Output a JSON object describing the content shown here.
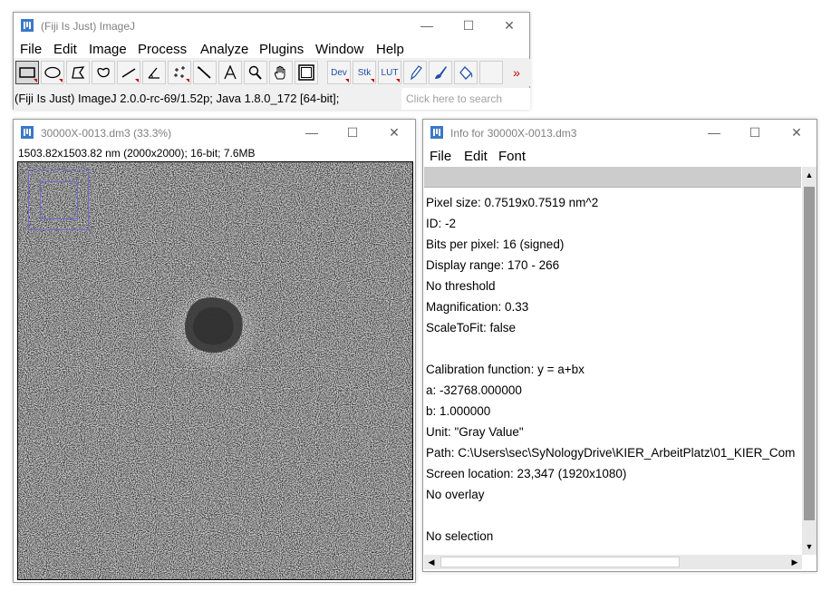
{
  "main_window": {
    "title": "(Fiji Is Just) ImageJ",
    "menus": [
      "File",
      "Edit",
      "Image",
      "Process",
      "Analyze",
      "Plugins",
      "Window",
      "Help"
    ],
    "tools": {
      "dev": "Dev",
      "stk": "Stk",
      "lut": "LUT",
      "more": "»"
    },
    "status": "(Fiji Is Just) ImageJ 2.0.0-rc-69/1.52p; Java 1.8.0_172 [64-bit];",
    "search_placeholder": "Click here to search"
  },
  "image_window": {
    "title": "30000X-0013.dm3 (33.3%)",
    "info": "1503.82x1503.82 nm (2000x2000); 16-bit; 7.6MB"
  },
  "info_window": {
    "title": "Info for 30000X-0013.dm3",
    "menus": [
      "File",
      "Edit",
      "Font"
    ],
    "lines": [
      "Pixel size: 0.7519x0.7519 nm^2",
      "ID: -2",
      "Bits per pixel: 16 (signed)",
      "Display range: 170 - 266",
      "No threshold",
      "Magnification: 0.33",
      "ScaleToFit: false",
      "",
      "Calibration function: y = a+bx",
      "  a: -32768.000000",
      "  b: 1.000000",
      "  Unit: \"Gray Value\"",
      "Path: C:\\Users\\sec\\SyNologyDrive\\KIER_ArbeitPlatz\\01_KIER_Com",
      "Screen location: 23,347 (1920x1080)",
      "No overlay",
      "",
      "No selection"
    ]
  },
  "window_controls": {
    "minimize": "—",
    "maximize": "☐",
    "close": "✕"
  },
  "colors": {
    "toolbar_bg": "#f0f0f0",
    "accent_red": "#c00000",
    "nav_box": "#6b6bd6",
    "ij_blue": "#3a78c8"
  }
}
